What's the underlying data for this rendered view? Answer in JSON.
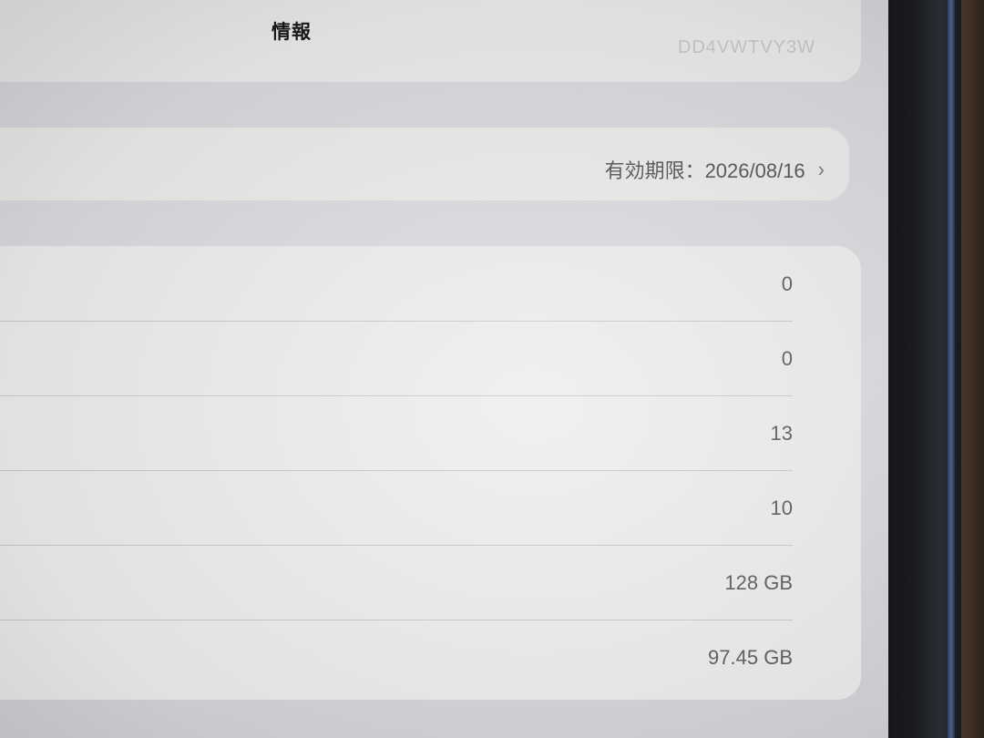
{
  "header": {
    "title": "情報",
    "serial_number": "DD4VWTVY3W"
  },
  "license": {
    "expiry_label": "有効期限：2026/08/16",
    "chevron": "›"
  },
  "rows": [
    {
      "value": "0"
    },
    {
      "value": "0"
    },
    {
      "value": "13"
    },
    {
      "value": "10"
    },
    {
      "value": "128 GB"
    },
    {
      "value": "97.45 GB"
    }
  ]
}
